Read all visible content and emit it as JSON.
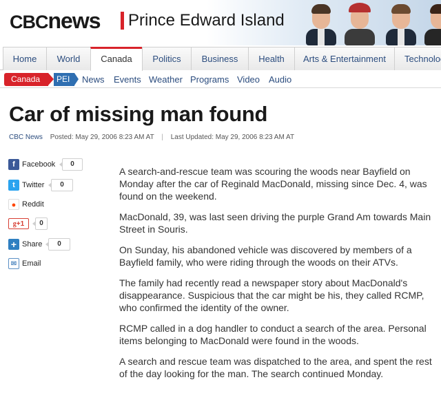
{
  "header": {
    "logo_cbc": "CBC",
    "logo_news": "news",
    "region": "Prince Edward Island"
  },
  "nav": {
    "tabs": [
      {
        "label": "Home"
      },
      {
        "label": "World"
      },
      {
        "label": "Canada",
        "active": true
      },
      {
        "label": "Politics"
      },
      {
        "label": "Business"
      },
      {
        "label": "Health"
      },
      {
        "label": "Arts & Entertainment"
      },
      {
        "label": "Technology"
      }
    ]
  },
  "subnav": {
    "breadcrumb_parent": "Canada",
    "breadcrumb_current": "PEI",
    "links": [
      "News",
      "Events",
      "Weather",
      "Programs",
      "Video",
      "Audio"
    ]
  },
  "article": {
    "title": "Car of missing man found",
    "source": "CBC News",
    "posted": "Posted: May 29, 2006 8:23 AM AT",
    "updated": "Last Updated: May 29, 2006 8:23 AM AT",
    "paragraphs": [
      "A search-and-rescue team was scouring the woods near Bayfield on Monday after the car of Reginald MacDonald, missing since Dec. 4, was found on the weekend.",
      "MacDonald, 39, was last seen driving the purple Grand Am towards Main Street in Souris.",
      "On Sunday, his abandoned vehicle was discovered by members of a Bayfield family, who were riding through the woods on their ATVs.",
      "The family had recently read a newspaper story about MacDonald's disappearance. Suspicious that the car might be his, they called RCMP, who confirmed the identity of the owner.",
      "RCMP called in a dog handler to conduct a search of the area. Personal items belonging to MacDonald were found in the woods.",
      "A search and rescue team was dispatched to the area, and spent the rest of the day looking for the man. The search continued Monday."
    ]
  },
  "share": {
    "facebook": {
      "label": "Facebook",
      "count": "0",
      "icon": "facebook-icon",
      "color": "#3b5998"
    },
    "twitter": {
      "label": "Twitter",
      "count": "0",
      "icon": "twitter-icon",
      "color": "#2aa3ef"
    },
    "reddit": {
      "label": "Reddit",
      "icon": "reddit-icon",
      "color": "#ff4500"
    },
    "gplus": {
      "label": "+1",
      "count": "0",
      "icon": "google-plus-icon",
      "color": "#d73d32"
    },
    "share": {
      "label": "Share",
      "count": "0",
      "icon": "share-plus-icon",
      "color": "#2f7fc1"
    },
    "email": {
      "label": "Email",
      "icon": "envelope-icon",
      "color": "#5a8fc4"
    }
  },
  "colors": {
    "brand_red": "#d8232a",
    "link_blue": "#2b4c7e",
    "pei_blue": "#2f6fb1"
  }
}
